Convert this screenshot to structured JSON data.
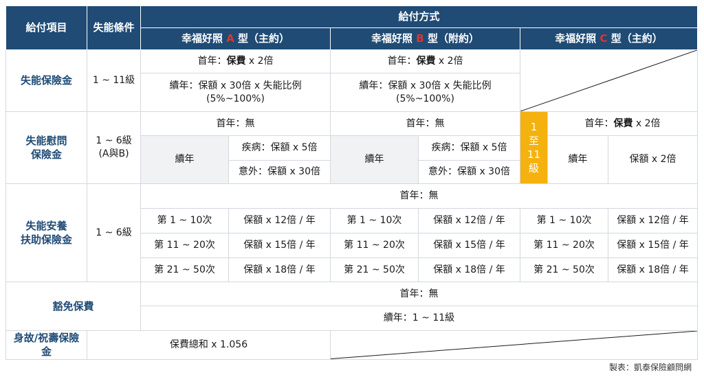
{
  "header": {
    "item": "給付項目",
    "condition": "失能條件",
    "method": "給付方式",
    "planA": {
      "prefix": "幸福好照 ",
      "letter": "A",
      "suffix": " 型（主約）"
    },
    "planB": {
      "prefix": "幸福好照 ",
      "letter": "B",
      "suffix": " 型（附約）"
    },
    "planC": {
      "prefix": "幸福好照 ",
      "letter": "C",
      "suffix": " 型（主約）"
    }
  },
  "rows": {
    "disability": {
      "label": "失能保險金",
      "condition": "1 ~ 11級",
      "firstYearPrefix": "首年：",
      "firstYearBold": "保費",
      "firstYearSuffix": " x 2倍",
      "renewLine1": "續年：保額 x 30倍 x 失能比例",
      "renewLine2": "(5%~100%)"
    },
    "consolation": {
      "label1": "失能慰問",
      "label2": "保險金",
      "condition1": "1 ~ 6級",
      "condition2": "(A與B)",
      "firstYear": "首年：無",
      "renewLabel": "續年",
      "illness": "疾病：保額 x 5倍",
      "accident": "意外：保額 x 30倍",
      "badge": [
        "1",
        "至",
        "11",
        "級"
      ],
      "cFirstPrefix": "首年：",
      "cFirstBold": "保費",
      "cFirstSuffix": " x 2倍",
      "cRenewLabel": "續年",
      "cRenewValue": "保額 x 2倍"
    },
    "care": {
      "label1": "失能安養",
      "label2": "扶助保險金",
      "condition": "1 ~ 6級",
      "firstYear": "首年：無",
      "tiers": [
        {
          "times": "第 1 ~ 10次",
          "amount": "保額 x 12倍 / 年"
        },
        {
          "times": "第 11 ~ 20次",
          "amount": "保額 x 15倍 / 年"
        },
        {
          "times": "第 21 ~ 50次",
          "amount": "保額 x 18倍 / 年"
        }
      ]
    },
    "waiver": {
      "label": "豁免保費",
      "firstYear": "首年：無",
      "renew": "續年：1 ~ 11級"
    },
    "death": {
      "label": "身故/祝壽保險金",
      "value": "保費總和 x 1.056"
    }
  },
  "caption": "製表：凱泰保險顧問網",
  "colors": {
    "header": "#1f4b75",
    "accent": "#e5322b",
    "badge": "#f5b20f"
  }
}
